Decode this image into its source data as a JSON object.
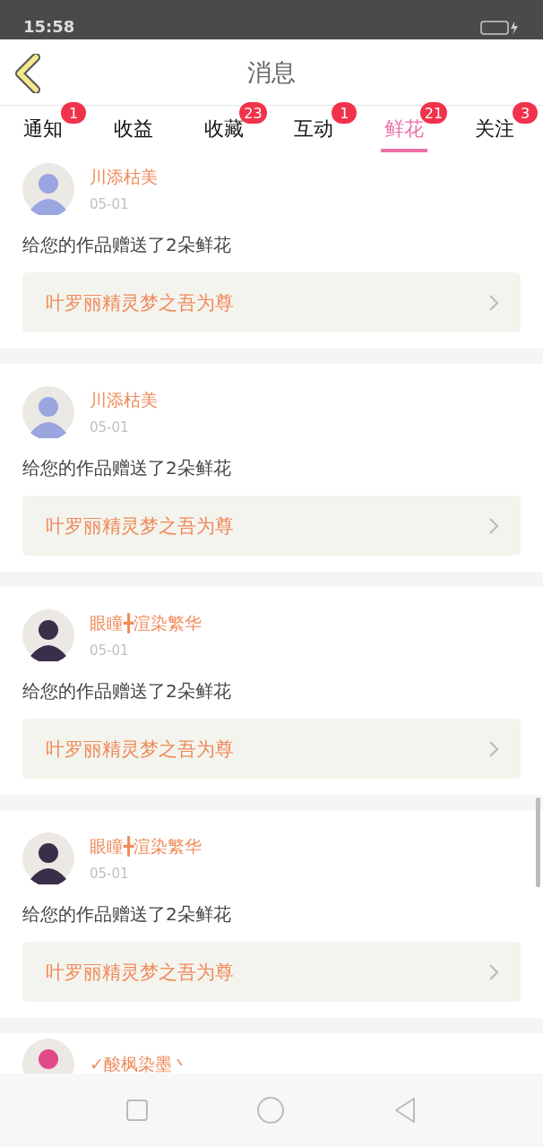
{
  "status_bar": {
    "time": "15:58"
  },
  "header": {
    "title": "消息"
  },
  "tabs": [
    {
      "label": "通知",
      "badge": "1",
      "selected": false
    },
    {
      "label": "收益",
      "selected": false
    },
    {
      "label": "收藏",
      "badge": "23",
      "selected": false
    },
    {
      "label": "互动",
      "badge": "1",
      "selected": false
    },
    {
      "label": "鲜花",
      "badge": "21",
      "selected": true
    },
    {
      "label": "关注",
      "badge": "3",
      "selected": false
    }
  ],
  "messages": [
    {
      "user": "川添枯美",
      "date": "05-01",
      "text": "给您的作品赠送了2朵鲜花",
      "work": "叶罗丽精灵梦之吾为尊",
      "color": "#9aa6e0"
    },
    {
      "user": "川添枯美",
      "date": "05-01",
      "text": "给您的作品赠送了2朵鲜花",
      "work": "叶罗丽精灵梦之吾为尊",
      "color": "#9aa6e0"
    },
    {
      "user": "眼瞳╋渲染繁华",
      "date": "05-01",
      "text": "给您的作品赠送了2朵鲜花",
      "work": "叶罗丽精灵梦之吾为尊",
      "color": "#3a2f4a"
    },
    {
      "user": "眼瞳╋渲染繁华",
      "date": "05-01",
      "text": "给您的作品赠送了2朵鲜花",
      "work": "叶罗丽精灵梦之吾为尊",
      "color": "#3a2f4a"
    },
    {
      "user": "✓酸枫染墨丶",
      "color": "#e04a86"
    }
  ]
}
